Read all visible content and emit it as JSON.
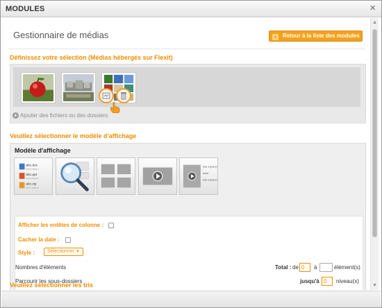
{
  "window": {
    "title": "MODULES",
    "close_glyph": "×"
  },
  "header": {
    "title": "Gestionnaire de médias",
    "back_button": "Retour à la liste des modules",
    "back_icon": "arrow-left-icon"
  },
  "selection": {
    "section_title": "Définissez votre sélection (Médias hébergés sur Flexit)",
    "add_files_label": "Ajouter des fichiers ou des dossiers",
    "thumbnails": [
      {
        "name": "apple-photo-thumbnail"
      },
      {
        "name": "sculpture-photo-thumbnail"
      },
      {
        "name": "image-collage-thumbnail"
      }
    ],
    "tools": [
      {
        "name": "edit-media-icon"
      },
      {
        "name": "delete-media-icon"
      }
    ]
  },
  "display": {
    "section_title": "Veuillez sélectionner le modèle d'affichage",
    "box_title": "Modèle d'affichage",
    "tiles": [
      {
        "name": "file-list-template",
        "items": [
          "abc.doc",
          "abc.ppt",
          "abc.zip"
        ],
        "caption": "lorem impsum"
      },
      {
        "name": "magnifier-template"
      },
      {
        "name": "grid-template"
      },
      {
        "name": "video-player-template"
      },
      {
        "name": "video-list-template",
        "items": [
          "lore a ipsum",
          "dolor",
          "lore a ipsum"
        ]
      }
    ],
    "options": {
      "column_headers_label": "Afficher les entêtes de colonne :",
      "hide_date_label": "Cacher la date :",
      "style_label": "Style :",
      "style_value": "Sélectionner",
      "item_count_label": "Nombres d'éléments",
      "total_label": "Total :",
      "from_label": "de",
      "from_value": "0",
      "to_label": "à",
      "to_value": "",
      "elements_label": "élément(s)",
      "subfolders_label": "Parcourir les sous-dossiers",
      "upto_label": "jusqu'à",
      "upto_value": "0",
      "levels_label": "niveau(x)"
    }
  },
  "sorting": {
    "section_title": "Veuillez sélectionner les tris"
  },
  "colors": {
    "accent": "#f08c00",
    "button": "#f4a11d",
    "highlight_circle": "#f39c1e"
  }
}
